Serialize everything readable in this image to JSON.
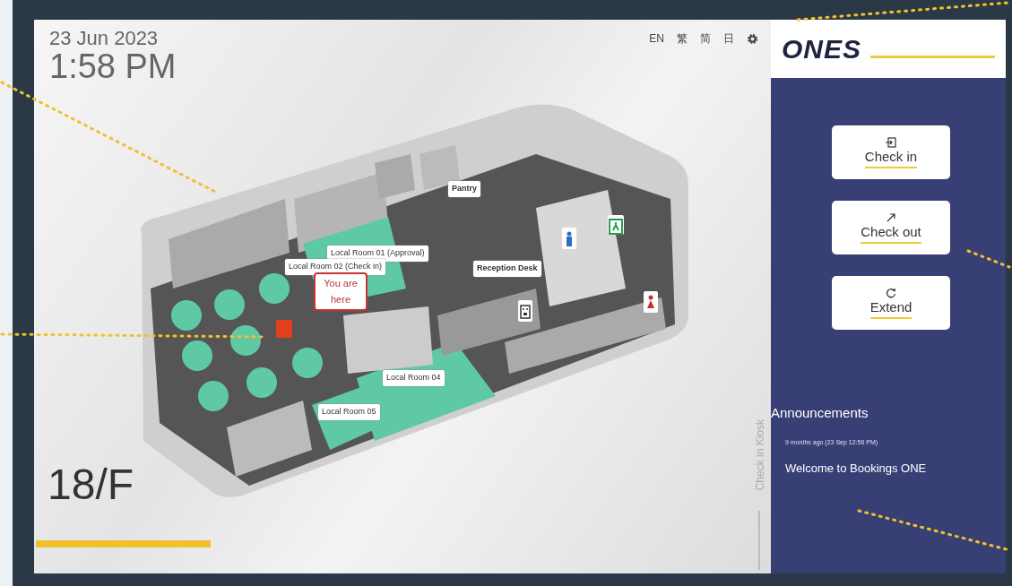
{
  "header": {
    "date": "23 Jun 2023",
    "time": "1:58 PM"
  },
  "languages": [
    "EN",
    "繁",
    "简",
    "日"
  ],
  "logo": {
    "text": "ONES"
  },
  "actions": [
    {
      "label": "Check in",
      "kind": "enter"
    },
    {
      "label": "Check out",
      "kind": "exit"
    },
    {
      "label": "Extend",
      "kind": "refresh"
    }
  ],
  "map": {
    "labels": [
      {
        "text": "Pantry",
        "kind": "facility"
      },
      {
        "text": "Local Room 01 (Approval)",
        "kind": "room"
      },
      {
        "text": "Local Room 02 (Check in)",
        "kind": "room"
      },
      {
        "text": "You are here",
        "kind": "marker"
      },
      {
        "text": "Reception Desk",
        "kind": "facility"
      },
      {
        "text": "Local Room 04",
        "kind": "room"
      },
      {
        "text": "Local Room 05",
        "kind": "room"
      }
    ]
  },
  "floor": "18/F",
  "side_label": "Check in Kiosk",
  "announcements": {
    "title": "Announcements",
    "items": [
      {
        "time": "9 months ago (23 Sep 12:56 PM)",
        "message": "Welcome to Bookings ONE"
      }
    ]
  }
}
